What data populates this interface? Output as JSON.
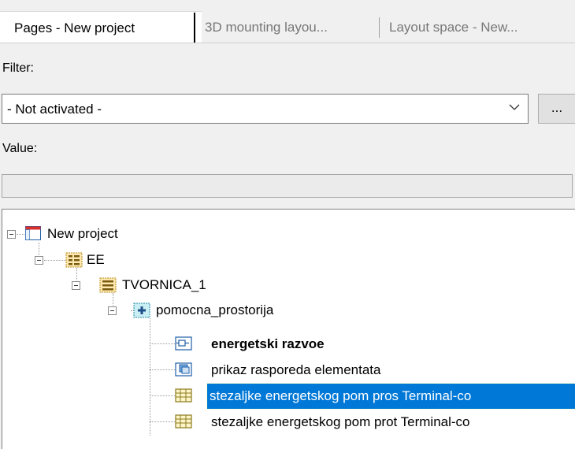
{
  "tabs": [
    {
      "label": "Pages - New project"
    },
    {
      "label": "3D mounting layou..."
    },
    {
      "label": "Layout space - New..."
    }
  ],
  "filter": {
    "label": "Filter:",
    "selected": "- Not activated -",
    "more_button": "..."
  },
  "value": {
    "label": "Value:",
    "text": ""
  },
  "tree": {
    "nodes": [
      {
        "label": "New project",
        "icon": "project-icon",
        "level": 0
      },
      {
        "label": "EE",
        "icon": "structure-icon",
        "level": 1
      },
      {
        "label": "TVORNICA_1",
        "icon": "structure-icon",
        "level": 2
      },
      {
        "label": "pomocna_prostorija",
        "icon": "location-icon",
        "level": 3
      },
      {
        "label": "energetski razvoe",
        "icon": "page-schematic-icon",
        "level": 4
      },
      {
        "label": "prikaz rasporeda elementata",
        "icon": "page-layout-icon",
        "level": 4
      },
      {
        "label": "stezaljke energetskog pom pros Terminal-co",
        "icon": "page-table-icon",
        "level": 4
      },
      {
        "label": "stezaljke energetskog pom prot Terminal-co",
        "icon": "page-table-icon",
        "level": 4
      }
    ],
    "selected": "stezaljke energetskog pom pros Terminal-co",
    "colors": {
      "selection": "#0078d7"
    }
  }
}
